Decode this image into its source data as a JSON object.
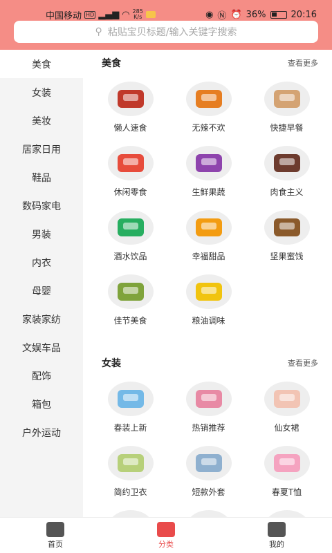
{
  "status": {
    "carrier": "中国移动",
    "hd": "HD",
    "speed_value": "285",
    "speed_unit": "K/s",
    "battery": "36%",
    "time": "20:16"
  },
  "search": {
    "placeholder": "粘贴宝贝标题/输入关键字搜索"
  },
  "sidebar": {
    "items": [
      {
        "label": "美食",
        "active": true
      },
      {
        "label": "女装"
      },
      {
        "label": "美妆"
      },
      {
        "label": "居家日用"
      },
      {
        "label": "鞋品"
      },
      {
        "label": "数码家电"
      },
      {
        "label": "男装"
      },
      {
        "label": "内衣"
      },
      {
        "label": "母婴"
      },
      {
        "label": "家装家纺"
      },
      {
        "label": "文娱车品"
      },
      {
        "label": "配饰"
      },
      {
        "label": "箱包"
      },
      {
        "label": "户外运动"
      }
    ]
  },
  "sections": [
    {
      "title": "美食",
      "more": "查看更多",
      "items": [
        {
          "label": "懒人速食",
          "icon": "instant-food-icon",
          "color": "#c0392b"
        },
        {
          "label": "无辣不欢",
          "icon": "spicy-food-icon",
          "color": "#e67e22"
        },
        {
          "label": "快捷早餐",
          "icon": "breakfast-bread-icon",
          "color": "#d4a373"
        },
        {
          "label": "休闲零食",
          "icon": "snacks-icon",
          "color": "#e74c3c"
        },
        {
          "label": "生鲜果蔬",
          "icon": "fresh-fruit-icon",
          "color": "#8e44ad"
        },
        {
          "label": "肉食主义",
          "icon": "meat-icon",
          "color": "#6d3b2e"
        },
        {
          "label": "酒水饮品",
          "icon": "drinks-icon",
          "color": "#27ae60"
        },
        {
          "label": "幸福甜品",
          "icon": "dessert-icon",
          "color": "#f39c12"
        },
        {
          "label": "坚果蜜饯",
          "icon": "nuts-icon",
          "color": "#8b5a2b"
        },
        {
          "label": "佳节美食",
          "icon": "festival-food-icon",
          "color": "#7fa33b"
        },
        {
          "label": "粮油调味",
          "icon": "grain-oil-icon",
          "color": "#f1c40f"
        }
      ]
    },
    {
      "title": "女装",
      "more": "查看更多",
      "items": [
        {
          "label": "春装上新",
          "icon": "spring-blouse-icon",
          "color": "#74b9e7"
        },
        {
          "label": "热销推荐",
          "icon": "hot-dress-icon",
          "color": "#e88aa5"
        },
        {
          "label": "仙女裙",
          "icon": "fairy-dress-icon",
          "color": "#f2c4b4"
        },
        {
          "label": "简约卫衣",
          "icon": "hoodie-icon",
          "color": "#b7d07a"
        },
        {
          "label": "短款外套",
          "icon": "denim-jacket-icon",
          "color": "#8fb0cf"
        },
        {
          "label": "春夏T恤",
          "icon": "tshirt-icon",
          "color": "#f5a3c0"
        },
        {
          "label": "",
          "icon": "sweater-icon",
          "color": "#c9b3e8"
        },
        {
          "label": "",
          "icon": "print-top-icon",
          "color": "#dcdcdc"
        },
        {
          "label": "",
          "icon": "orange-top-icon",
          "color": "#f0a64a"
        }
      ]
    }
  ],
  "tabs": [
    {
      "label": "首页",
      "icon": "home-icon",
      "active": false
    },
    {
      "label": "分类",
      "icon": "category-icon",
      "active": true
    },
    {
      "label": "我的",
      "icon": "profile-icon",
      "active": false
    }
  ]
}
